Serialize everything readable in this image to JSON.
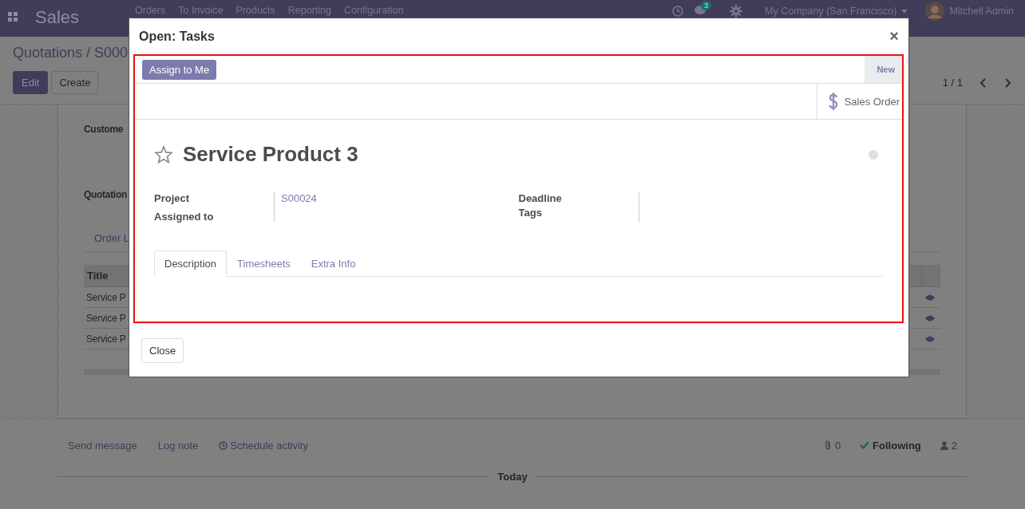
{
  "navbar": {
    "app_name": "Sales",
    "menu": [
      "Orders",
      "To Invoice",
      "Products",
      "Reporting",
      "Configuration"
    ],
    "message_count": "3",
    "company": "My Company (San Francisco)",
    "user": "Mitchell Admin"
  },
  "control_panel": {
    "breadcrumb": "Quotations / S000",
    "buttons": [
      "Edit",
      "Create"
    ],
    "pager": "1 / 1"
  },
  "sheet": {
    "labels": [
      "Custome",
      "Quotation"
    ],
    "tab": "Order L",
    "table": {
      "columns": [
        "Title"
      ],
      "rows": [
        "Service P",
        "Service P",
        "Service P"
      ]
    }
  },
  "chatter": {
    "actions": [
      "Send message",
      "Log note",
      "Schedule activity"
    ],
    "attachments": "0",
    "follow": "Following",
    "followers": "2",
    "date_separator": "Today"
  },
  "dialog": {
    "title": "Open: Tasks",
    "close_icon": "×",
    "assign_button": "Assign to Me",
    "stage": "New",
    "smart_button": "Sales Order",
    "task_title": "Service Product 3",
    "starred": false,
    "fields_left": [
      {
        "label": "Project",
        "value": "S00024"
      },
      {
        "label": "Assigned to"
      }
    ],
    "fields_right": [
      {
        "label": "Deadline"
      },
      {
        "label": "Tags"
      }
    ],
    "tabs": [
      {
        "label": "Description",
        "selected": true
      },
      {
        "label": "Timesheets",
        "selected": false
      },
      {
        "label": "Extra Info",
        "selected": false
      }
    ],
    "footer_button": "Close"
  }
}
